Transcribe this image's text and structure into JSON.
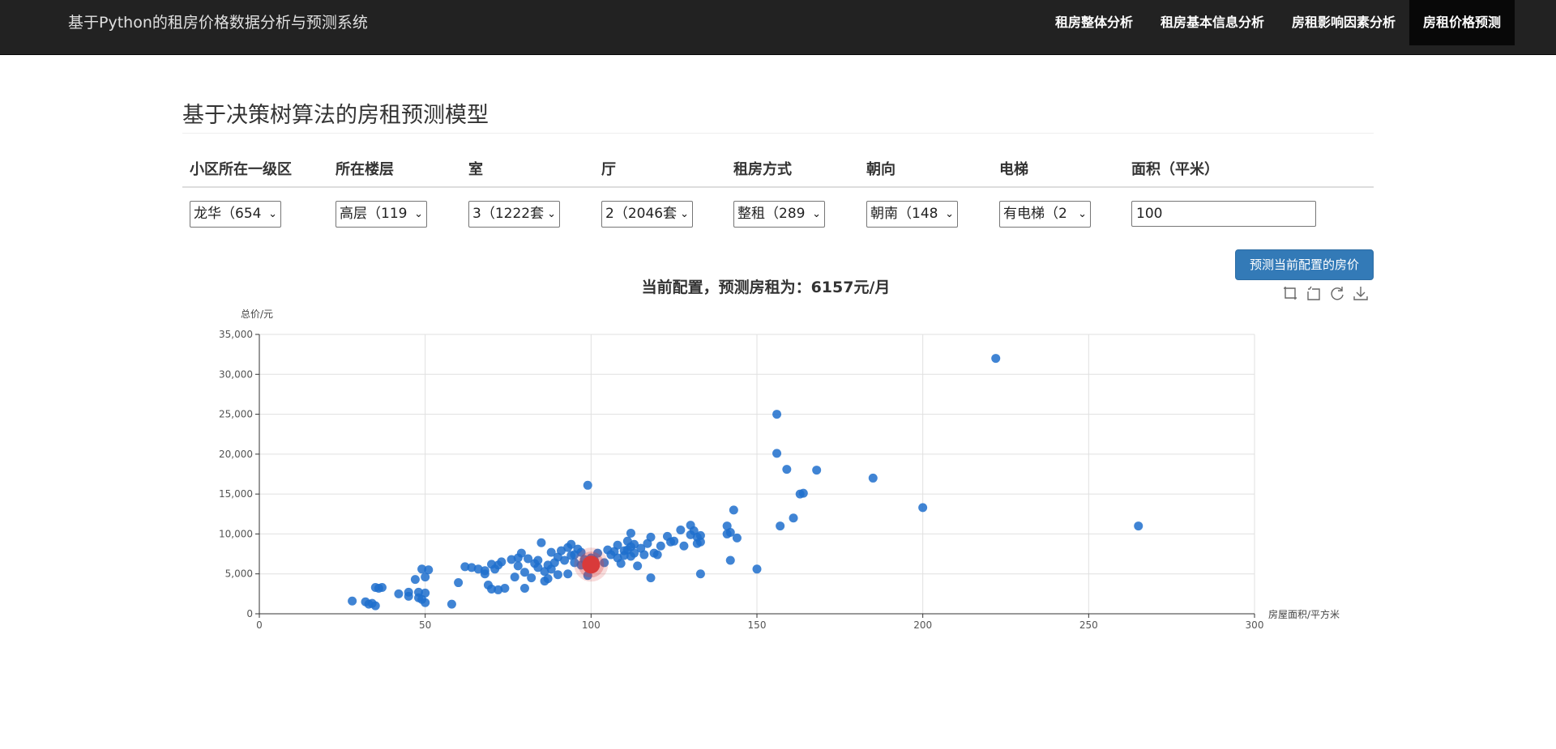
{
  "brand": "基于Python的租房价格数据分析与预测系统",
  "nav": [
    {
      "label": "租房整体分析",
      "active": false
    },
    {
      "label": "租房基本信息分析",
      "active": false
    },
    {
      "label": "房租影响因素分析",
      "active": false
    },
    {
      "label": "房租价格预测",
      "active": true
    }
  ],
  "page_title": "基于决策树算法的房租预测模型",
  "form": {
    "headers": [
      "小区所在一级区",
      "所在楼层",
      "室",
      "厅",
      "租房方式",
      "朝向",
      "电梯",
      "面积（平米）"
    ],
    "selects": [
      {
        "name": "district-select",
        "value": "龙华（654"
      },
      {
        "name": "floor-select",
        "value": "高层（119"
      },
      {
        "name": "room-select",
        "value": "3（1222套"
      },
      {
        "name": "hall-select",
        "value": "2（2046套"
      },
      {
        "name": "rent-type-select",
        "value": "整租（289"
      },
      {
        "name": "orientation-select",
        "value": "朝南（148"
      },
      {
        "name": "elevator-select",
        "value": "有电梯（2"
      }
    ],
    "area_value": "100",
    "predict_button": "预测当前配置的房价"
  },
  "toolbox": [
    "zoom-icon",
    "zoom-reset-icon",
    "restore-icon",
    "save-image-icon"
  ],
  "chart_data": {
    "type": "scatter",
    "title": "当前配置，预测房租为：6157元/月",
    "xlabel": "房屋面积/平方米",
    "ylabel": "总价/元",
    "xlim": [
      0,
      300
    ],
    "ylim": [
      0,
      35000
    ],
    "x_ticks": [
      "0",
      "50",
      "100",
      "150",
      "200",
      "250",
      "300"
    ],
    "y_ticks": [
      "0",
      "5,000",
      "10,000",
      "15,000",
      "20,000",
      "25,000",
      "30,000",
      "35,000"
    ],
    "grid": true,
    "point_color": "#1f6fcc",
    "highlight_color": "#d93a3a",
    "highlight": {
      "x": 100,
      "y": 6157
    },
    "points": [
      [
        28,
        1600
      ],
      [
        32,
        1500
      ],
      [
        33,
        1200
      ],
      [
        34,
        1300
      ],
      [
        35,
        3300
      ],
      [
        35,
        1000
      ],
      [
        36,
        3200
      ],
      [
        37,
        3300
      ],
      [
        42,
        2500
      ],
      [
        45,
        2700
      ],
      [
        45,
        2200
      ],
      [
        47,
        4300
      ],
      [
        48,
        2700
      ],
      [
        48,
        2000
      ],
      [
        49,
        1800
      ],
      [
        49,
        5600
      ],
      [
        50,
        2600
      ],
      [
        50,
        1400
      ],
      [
        50,
        4600
      ],
      [
        51,
        5500
      ],
      [
        58,
        1200
      ],
      [
        60,
        3900
      ],
      [
        62,
        5900
      ],
      [
        64,
        5800
      ],
      [
        66,
        5600
      ],
      [
        68,
        5000
      ],
      [
        68,
        5400
      ],
      [
        69,
        3600
      ],
      [
        70,
        6200
      ],
      [
        70,
        3100
      ],
      [
        71,
        5600
      ],
      [
        72,
        6100
      ],
      [
        72,
        3000
      ],
      [
        73,
        6500
      ],
      [
        74,
        3200
      ],
      [
        76,
        6800
      ],
      [
        77,
        4600
      ],
      [
        78,
        7000
      ],
      [
        78,
        6000
      ],
      [
        79,
        7600
      ],
      [
        80,
        5200
      ],
      [
        80,
        3200
      ],
      [
        81,
        6900
      ],
      [
        82,
        4500
      ],
      [
        83,
        6300
      ],
      [
        84,
        6700
      ],
      [
        84,
        5800
      ],
      [
        85,
        8900
      ],
      [
        86,
        5300
      ],
      [
        86,
        4100
      ],
      [
        87,
        6100
      ],
      [
        87,
        4400
      ],
      [
        88,
        7700
      ],
      [
        88,
        5600
      ],
      [
        89,
        6400
      ],
      [
        90,
        7100
      ],
      [
        90,
        4900
      ],
      [
        91,
        7900
      ],
      [
        92,
        6700
      ],
      [
        93,
        8300
      ],
      [
        93,
        5000
      ],
      [
        94,
        8700
      ],
      [
        94,
        7300
      ],
      [
        95,
        7400
      ],
      [
        95,
        6400
      ],
      [
        96,
        8100
      ],
      [
        97,
        7700
      ],
      [
        97,
        6100
      ],
      [
        98,
        6800
      ],
      [
        99,
        4800
      ],
      [
        99,
        16100
      ],
      [
        100,
        7000
      ],
      [
        101,
        6700
      ],
      [
        102,
        7600
      ],
      [
        104,
        6400
      ],
      [
        105,
        8000
      ],
      [
        106,
        7400
      ],
      [
        107,
        7800
      ],
      [
        108,
        8600
      ],
      [
        108,
        7000
      ],
      [
        109,
        6300
      ],
      [
        110,
        7900
      ],
      [
        110,
        7300
      ],
      [
        111,
        9100
      ],
      [
        111,
        8000
      ],
      [
        112,
        10100
      ],
      [
        112,
        8400
      ],
      [
        112,
        7200
      ],
      [
        113,
        8700
      ],
      [
        113,
        7600
      ],
      [
        114,
        6000
      ],
      [
        115,
        8200
      ],
      [
        116,
        7400
      ],
      [
        117,
        8800
      ],
      [
        118,
        9600
      ],
      [
        118,
        4500
      ],
      [
        119,
        7600
      ],
      [
        120,
        7400
      ],
      [
        121,
        8500
      ],
      [
        123,
        9700
      ],
      [
        124,
        9000
      ],
      [
        125,
        9100
      ],
      [
        127,
        10500
      ],
      [
        128,
        8500
      ],
      [
        130,
        11100
      ],
      [
        130,
        9900
      ],
      [
        131,
        10400
      ],
      [
        132,
        9600
      ],
      [
        132,
        8800
      ],
      [
        133,
        9800
      ],
      [
        133,
        9000
      ],
      [
        133,
        5000
      ],
      [
        141,
        11000
      ],
      [
        141,
        10000
      ],
      [
        142,
        10200
      ],
      [
        142,
        6700
      ],
      [
        143,
        13000
      ],
      [
        144,
        9500
      ],
      [
        150,
        5600
      ],
      [
        156,
        25000
      ],
      [
        156,
        20100
      ],
      [
        157,
        11000
      ],
      [
        159,
        18100
      ],
      [
        161,
        12000
      ],
      [
        163,
        15000
      ],
      [
        164,
        15100
      ],
      [
        168,
        18000
      ],
      [
        185,
        17000
      ],
      [
        200,
        13300
      ],
      [
        222,
        32000
      ],
      [
        265,
        11000
      ]
    ]
  }
}
